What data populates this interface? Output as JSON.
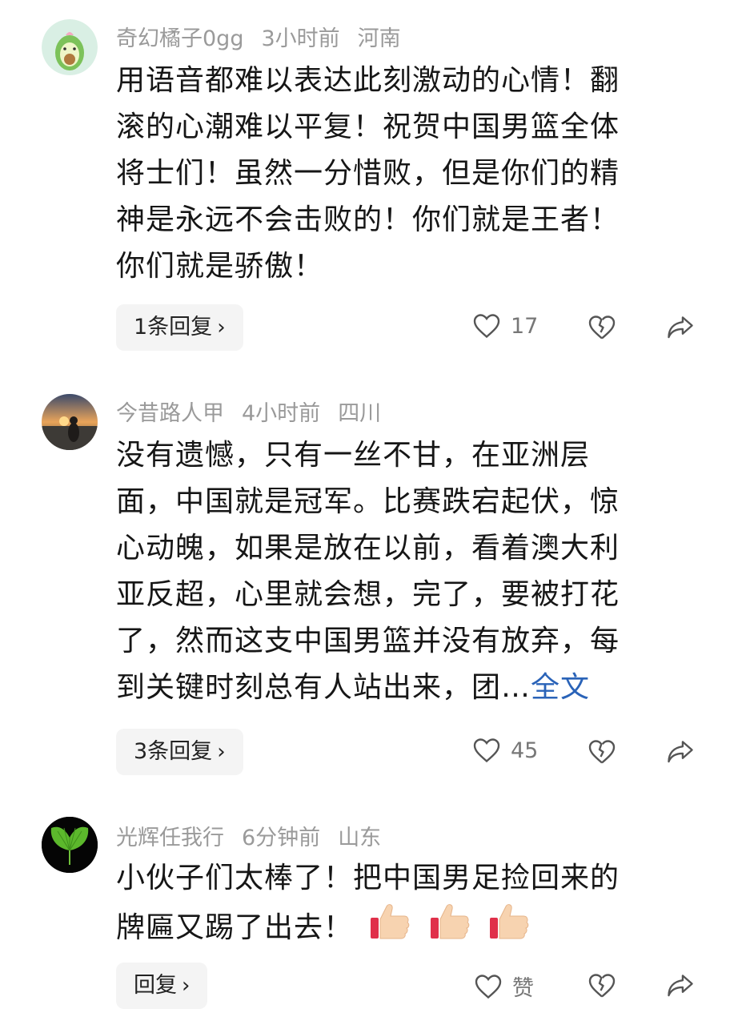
{
  "comments": [
    {
      "user": "奇幻橘子0gg",
      "time": "3小时前",
      "location": "河南",
      "lines": [
        "用语音都难以表达此刻激动的心情！翻",
        "滚的心潮难以平复！祝贺中国男篮全体",
        "将士们！虽然一分惜败，但是你们的精",
        "神是永远不会击败的！你们就是王者！",
        "你们就是骄傲！"
      ],
      "reply_label": "1条回复",
      "like_count": "17"
    },
    {
      "user": "今昔路人甲",
      "time": "4小时前",
      "location": "四川",
      "lines": [
        "没有遗憾，只有一丝不甘，在亚洲层",
        "面，中国就是冠军。比赛跌宕起伏，惊",
        "心动魄，如果是放在以前，看着澳大利",
        "亚反超，心里就会想，完了，要被打花",
        "了，然而这支中国男篮并没有放弃，每",
        "到关键时刻总有人站出来，团…"
      ],
      "more_label": "全文",
      "reply_label": "3条回复",
      "like_count": "45"
    },
    {
      "user": "光辉任我行",
      "time": "6分钟前",
      "location": "山东",
      "lines": [
        "小伙子们太棒了！把中国男足捡回来的",
        "牌匾又踢了出去！"
      ],
      "emoji_icon": "thumbs-up-icon",
      "reply_label": "回复",
      "like_count": "赞"
    }
  ],
  "colors": {
    "meta": "#9a9a9a",
    "link": "#2a63b8",
    "reply_bg": "#f4f4f4"
  }
}
